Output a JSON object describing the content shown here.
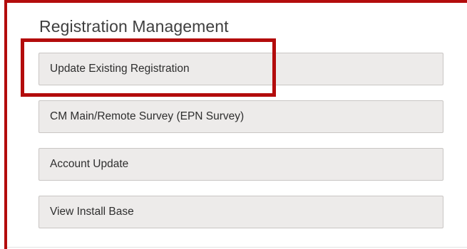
{
  "panel": {
    "title": "Registration Management"
  },
  "buttons": [
    {
      "label": "Update Existing Registration"
    },
    {
      "label": "CM Main/Remote Survey (EPN Survey)"
    },
    {
      "label": "Account Update"
    },
    {
      "label": "View Install Base"
    }
  ],
  "colors": {
    "accent_red": "#b30c0c",
    "button_bg": "#edebea",
    "button_border": "#c9c6c4",
    "title_text": "#3f3f3f"
  }
}
